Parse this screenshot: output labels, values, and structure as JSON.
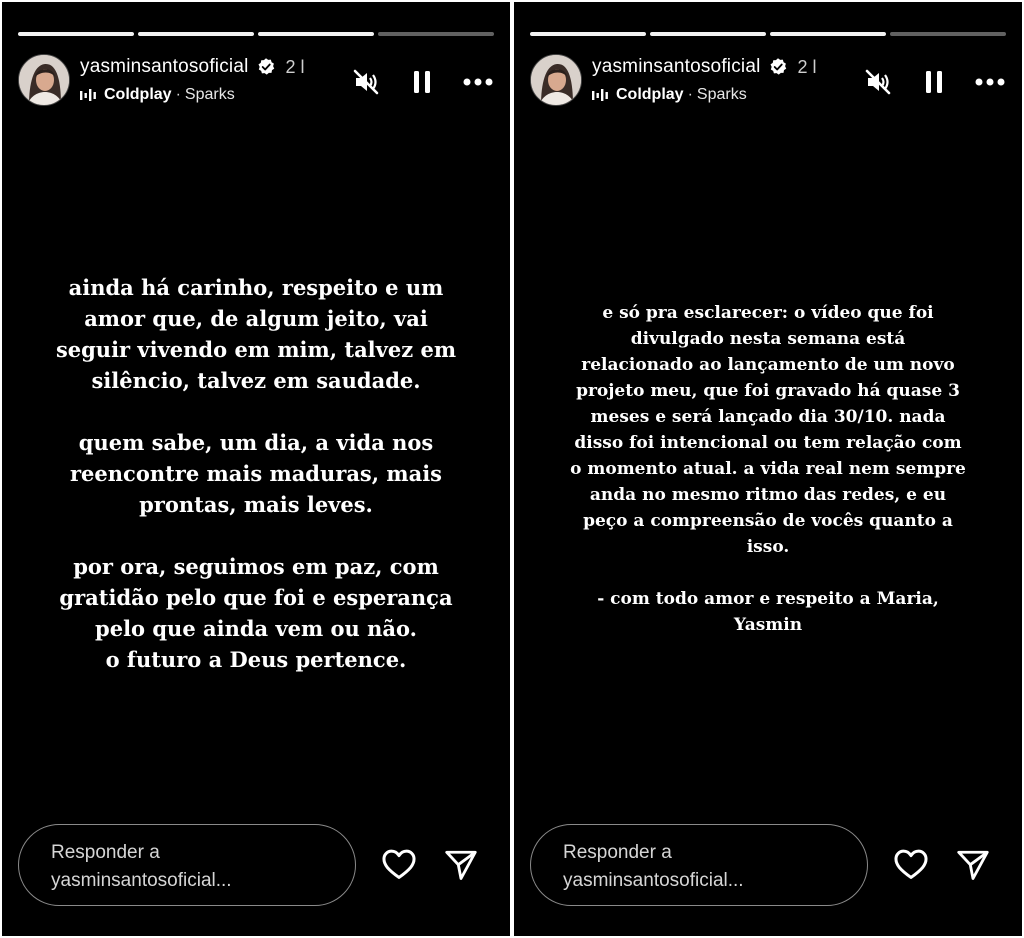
{
  "stories": [
    {
      "id": "left",
      "progress": [
        1,
        1,
        1,
        0
      ],
      "username": "yasminsantosoficial",
      "time": "2 l",
      "music": {
        "artist": "Coldplay",
        "separator": "·",
        "song": "Sparks"
      },
      "text_paragraphs": [
        [
          "ainda há carinho, respeito e um",
          "amor que, de algum jeito, vai",
          "seguir vivendo em mim, talvez em",
          "silêncio, talvez em saudade."
        ],
        [
          "quem sabe, um dia, a vida nos",
          "reencontre mais maduras, mais",
          "prontas, mais leves."
        ],
        [
          "por ora, seguimos em paz, com",
          "gratidão pelo que foi e esperança",
          "pelo que ainda vem ou não.",
          "o futuro a Deus pertence."
        ]
      ],
      "reply": {
        "line1": "Responder a",
        "line2": "yasminsantosoficial..."
      }
    },
    {
      "id": "right",
      "progress": [
        1,
        1,
        1,
        0
      ],
      "username": "yasminsantosoficial",
      "time": "2 l",
      "music": {
        "artist": "Coldplay",
        "separator": "·",
        "song": "Sparks"
      },
      "text_paragraphs": [
        [
          "e só pra esclarecer: o vídeo que foi",
          "divulgado nesta semana está",
          "relacionado ao lançamento de um novo",
          "projeto meu, que foi gravado há quase 3",
          "meses e será lançado dia 30/10. nada",
          "disso foi intencional ou tem relação com",
          "o momento atual. a vida real nem sempre",
          "anda no mesmo ritmo das redes, e eu",
          "peço a compreensão de vocês quanto a",
          "isso."
        ],
        [
          "- com todo amor e respeito a Maria,",
          "Yasmin"
        ]
      ],
      "reply": {
        "line1": "Responder a",
        "line2": "yasminsantosoficial..."
      }
    }
  ],
  "icons": {
    "verified": "verified-badge-icon",
    "music": "equalizer-icon",
    "mute": "speaker-muted-icon",
    "pause": "pause-icon",
    "more": "more-options-icon",
    "like": "heart-icon",
    "share": "send-icon"
  },
  "colors": {
    "background": "#000000",
    "text": "#ffffff",
    "secondary_text": "#cfcfcf",
    "reply_border": "#8a8a8a"
  }
}
